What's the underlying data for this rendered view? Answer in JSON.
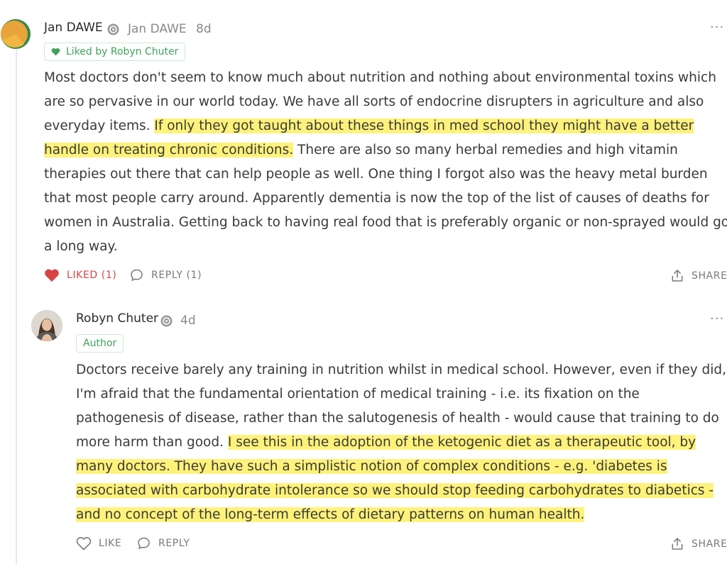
{
  "comment": {
    "author": "Jan DAWE",
    "handle": "Jan DAWE",
    "age": "8d",
    "liked_by": "Liked by Robyn Chuter",
    "body": {
      "pre": "Most doctors don't seem to know much about nutrition and nothing about environmental toxins which are so pervasive in our world today. We have all sorts of endocrine disrupters in agriculture and also everyday items. ",
      "highlight": "If only they got taught about these things in med school they might have a better handle on treating chronic conditions.",
      "post": " There are also so many herbal remedies and high vitamin therapies out there that can help people as well. One thing I forgot also was the heavy metal burden that most people carry around. Apparently dementia is now the top of the list of causes of deaths for women in Australia. Getting back to having real food that is preferably organic or non-sprayed would go a long way."
    },
    "actions": {
      "like_label": "LIKED (1)",
      "reply_label": "REPLY (1)",
      "share_label": "SHARE"
    },
    "more_label": "···"
  },
  "reply": {
    "author": "Robyn Chuter",
    "age": "4d",
    "author_badge": "Author",
    "body": {
      "pre": "Doctors receive barely any training in nutrition whilst in medical school. However, even if they did, I'm afraid that the fundamental orientation of medical training - i.e. its fixation on the pathogenesis of disease, rather than the salutogenesis of health - would cause that training to do more harm than good. ",
      "highlight": "I see this in the adoption of the ketogenic diet as a therapeutic tool, by many doctors. They have such a simplistic notion of complex conditions - e.g. 'diabetes is associated with carbohydrate intolerance so we should stop feeding carbohydrates to diabetics - and no concept of the long-term effects of dietary patterns on human health."
    },
    "actions": {
      "like_label": "LIKE",
      "reply_label": "REPLY",
      "share_label": "SHARE"
    },
    "more_label": "···"
  },
  "colors": {
    "highlight": "#fff27a",
    "liked": "#d64545",
    "green": "#3ea35b",
    "muted": "#8a8a8a"
  },
  "icons": [
    "heart-icon",
    "comment-icon",
    "share-icon",
    "badge-icon",
    "more-icon"
  ]
}
